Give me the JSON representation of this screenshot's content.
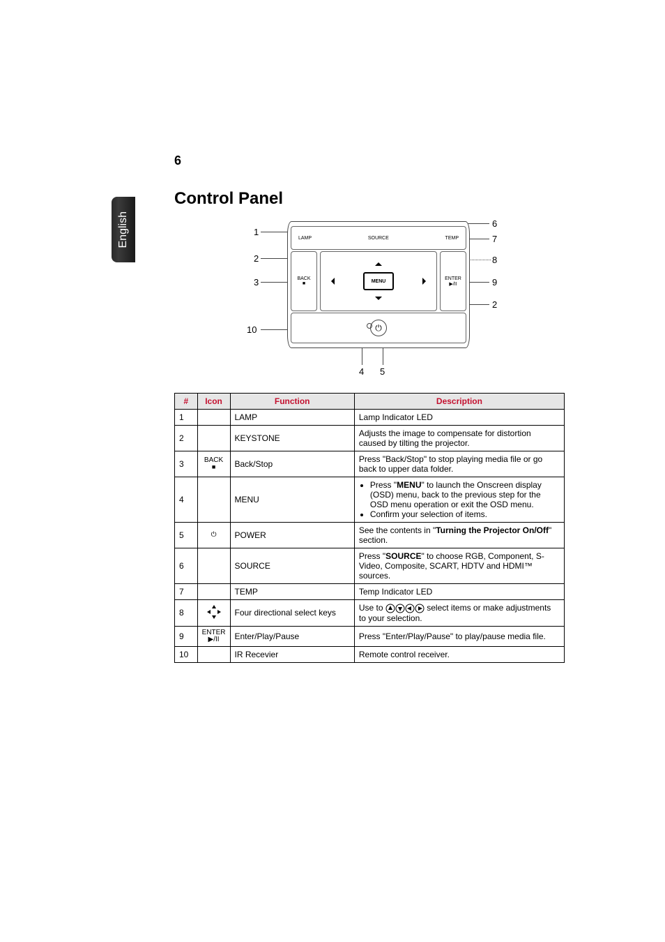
{
  "page_number": "6",
  "sidebar_label": "English",
  "section_title": "Control Panel",
  "diagram": {
    "top_left_label": "LAMP",
    "top_center_label": "SOURCE",
    "top_right_label": "TEMP",
    "left_btn_top": "BACK",
    "left_btn_sym": "■",
    "menu_label": "MENU",
    "right_btn_top": "ENTER",
    "right_btn_sym": "▶/II",
    "power_sym": "⏻",
    "callouts": {
      "c1": "1",
      "c2a": "2",
      "c2b": "2",
      "c3": "3",
      "c4": "4",
      "c5": "5",
      "c6": "6",
      "c7": "7",
      "c8": "8",
      "c9": "9",
      "c10": "10"
    }
  },
  "table": {
    "headers": {
      "num": "#",
      "icon": "Icon",
      "func": "Function",
      "desc": "Description"
    },
    "rows": [
      {
        "num": "1",
        "icon": "",
        "func": "LAMP",
        "desc_plain": "Lamp Indicator LED"
      },
      {
        "num": "2",
        "icon": "",
        "func": "KEYSTONE",
        "desc_plain": "Adjusts the image to compensate for distortion caused by tilting the projector."
      },
      {
        "num": "3",
        "icon": "back",
        "func": "Back/Stop",
        "desc_plain": "Press \"Back/Stop\" to stop playing media file or go back to upper data folder."
      },
      {
        "num": "4",
        "icon": "",
        "func": "MENU",
        "desc_ul": [
          {
            "pre": "Press \"",
            "bold": "MENU",
            "post": "\" to launch the Onscreen display (OSD) menu, back to the previous step for the OSD menu operation or exit the OSD menu."
          },
          {
            "plain": "Confirm your selection of items."
          }
        ]
      },
      {
        "num": "5",
        "icon": "power",
        "func": "POWER",
        "desc_rich": {
          "pre": "See the contents in \"",
          "bold": "Turning the Projector On/Off",
          "post": "\" section."
        }
      },
      {
        "num": "6",
        "icon": "",
        "func": "SOURCE",
        "desc_rich": {
          "pre": "Press \"",
          "bold": "SOURCE",
          "post": "\" to choose RGB, Component, S-Video, Composite, SCART, HDTV and HDMI™ sources."
        }
      },
      {
        "num": "7",
        "icon": "",
        "func": "TEMP",
        "desc_plain": "Temp Indicator LED"
      },
      {
        "num": "8",
        "icon": "dpad",
        "func": "Four directional select keys",
        "desc_arrows": {
          "pre": "Use to ",
          "post": " select items or make adjustments to your selection."
        }
      },
      {
        "num": "9",
        "icon": "enter",
        "func": "Enter/Play/Pause",
        "desc_plain": "Press \"Enter/Play/Pause\" to play/pause media file."
      },
      {
        "num": "10",
        "icon": "",
        "func": "IR Recevier",
        "desc_plain": "Remote control receiver."
      }
    ],
    "icon_labels": {
      "back_text": "BACK",
      "back_sym": "■",
      "power_sym": "⏻",
      "enter_text": "ENTER",
      "enter_sym": "▶/II"
    }
  }
}
